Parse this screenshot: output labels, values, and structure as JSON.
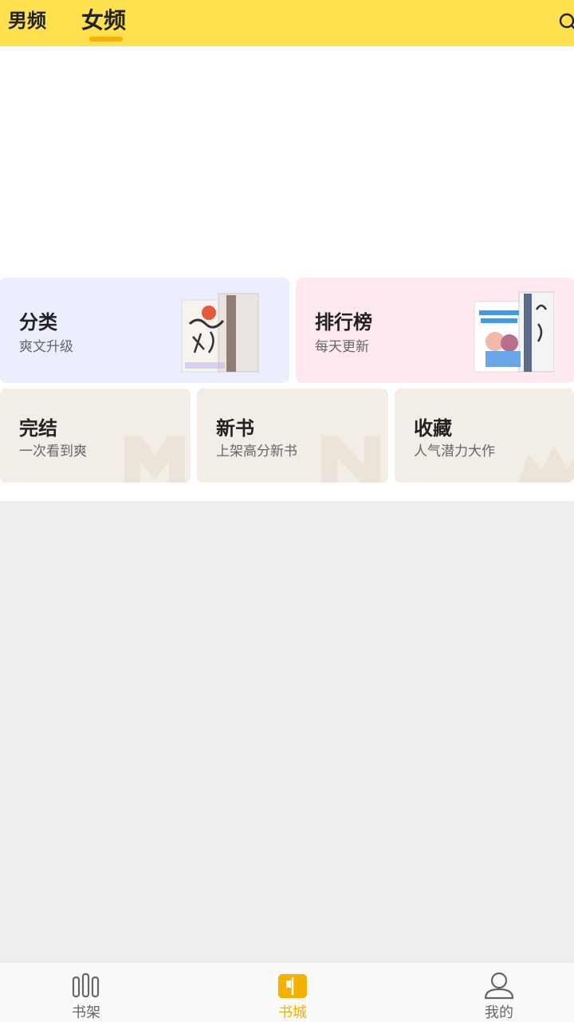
{
  "header": {
    "tabs": [
      {
        "label": "男频",
        "active": false
      },
      {
        "label": "女频",
        "active": true
      }
    ],
    "accent_color": "#ffe04f"
  },
  "entries": {
    "category": {
      "title": "分类",
      "subtitle": "爽文升级"
    },
    "ranking": {
      "title": "排行榜",
      "subtitle": "每天更新"
    },
    "finished": {
      "title": "完结",
      "subtitle": "一次看到爽"
    },
    "new_books": {
      "title": "新书",
      "subtitle": "上架高分新书"
    },
    "favorites": {
      "title": "收藏",
      "subtitle": "人气潜力大作"
    }
  },
  "bottom_nav": {
    "items": [
      {
        "label": "书架",
        "icon": "bookshelf-icon",
        "active": false
      },
      {
        "label": "书城",
        "icon": "open-book-icon",
        "active": true
      },
      {
        "label": "我的",
        "icon": "user-icon",
        "active": false
      }
    ],
    "active_color": "#f6b000"
  }
}
